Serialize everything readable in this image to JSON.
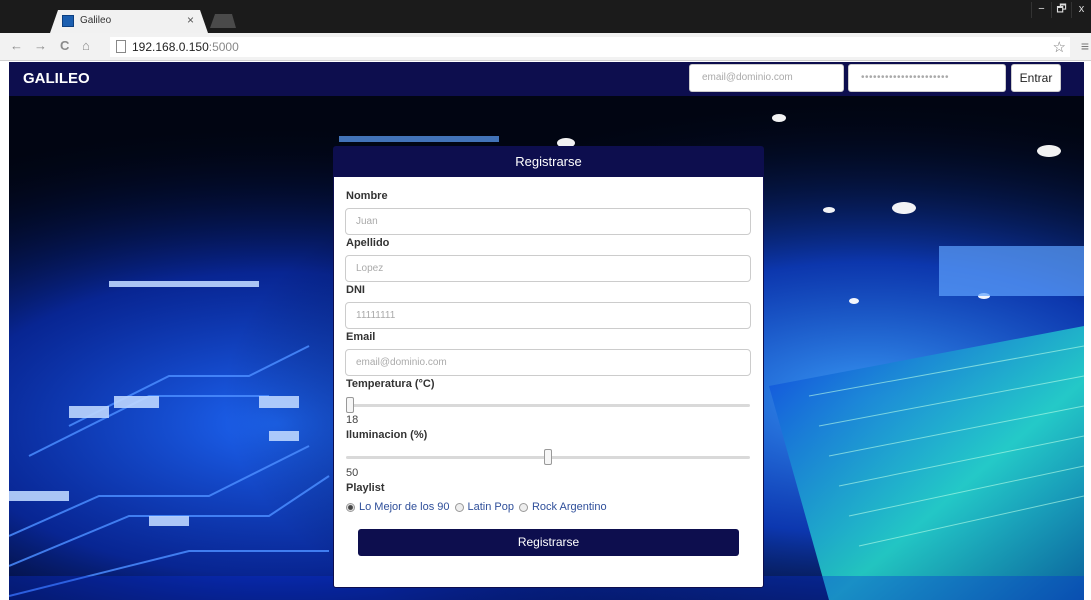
{
  "browser": {
    "tab_title": "Galileo",
    "tab_close": "×",
    "url_host": "192.168.0.150",
    "url_port": ":5000",
    "nav_back": "←",
    "nav_forward": "→",
    "nav_reload": "C",
    "nav_home": "⌂",
    "bookmark_icon": "star-icon",
    "window_controls": {
      "minimize": "−",
      "restore": "🗗",
      "close": "x"
    }
  },
  "navbar": {
    "brand": "GALILEO",
    "email_placeholder": "email@dominio.com",
    "password_placeholder": "••••••••••••••••••••••",
    "login_button": "Entrar"
  },
  "form": {
    "title": "Registrarse",
    "fields": {
      "nombre": {
        "label": "Nombre",
        "placeholder": "Juan"
      },
      "apellido": {
        "label": "Apellido",
        "placeholder": "Lopez"
      },
      "dni": {
        "label": "DNI",
        "placeholder": "11111111"
      },
      "email": {
        "label": "Email",
        "placeholder": "email@dominio.com"
      }
    },
    "temperatura": {
      "label": "Temperatura (°C)",
      "value": "18"
    },
    "iluminacion": {
      "label": "Iluminacion (%)",
      "value": "50"
    },
    "playlist": {
      "label": "Playlist",
      "options": [
        "Lo Mejor de los 90",
        "Latin Pop",
        "Rock Argentino"
      ],
      "selected": "Lo Mejor de los 90"
    },
    "submit": "Registrarse"
  },
  "colors": {
    "brand_navy": "#0d0e4e",
    "background_circuit": "#0a2fd6",
    "radio_text": "#2f4f9a"
  }
}
